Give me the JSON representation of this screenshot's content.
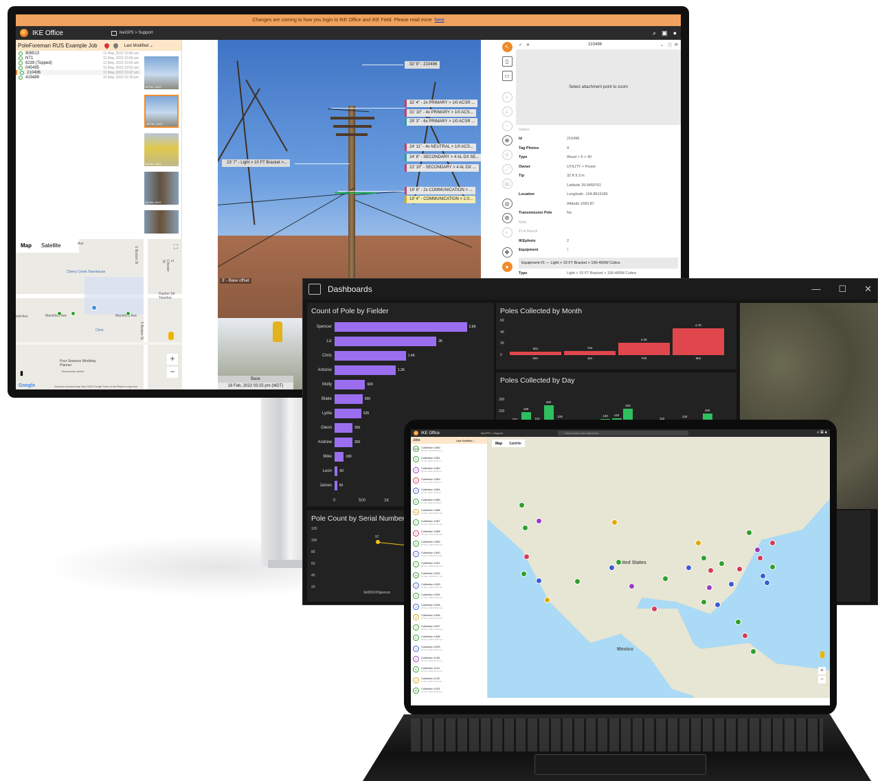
{
  "desktop": {
    "banner": {
      "text": "Changes are coming to how you login to IKE Office and IKE Field. Please read more",
      "link": "here"
    },
    "app_title": "IKE Office",
    "breadcrumb": "IkeGPS > Support",
    "job": {
      "name": "PoleForeman RUS Example Job",
      "sort_label": "Last Modified"
    },
    "poles": [
      {
        "id": "906513",
        "date": "11 May, 2022 10:55 am"
      },
      {
        "id": "NT1",
        "date": "11 May, 2022 10:55 am"
      },
      {
        "id": "6239 (Topped)",
        "date": "11 May, 2022 10:55 am"
      },
      {
        "id": "045495",
        "date": "11 May, 2022 10:52 am"
      },
      {
        "id": "210496",
        "date": "11 May, 2022 10:47 am"
      },
      {
        "id": "419489",
        "date": "10 May, 2022 02:30 pm"
      }
    ],
    "thumb_dates": [
      "18 Feb, 2022",
      "18 Feb, 2022",
      "18 Feb, 2022",
      "18 Feb, 2022"
    ],
    "map": {
      "tabs": [
        "Map",
        "Satellite"
      ],
      "labels": [
        "Cherry Creek Townhouse",
        "Dayton Str Townhor",
        "Mansfield Ave",
        "Mansfield Ave",
        "Four Seasons Wedding Planner",
        "Temporarily closed",
        "Chris",
        "S Boston St",
        "S Chester St",
        "Ave",
        "S Boston St",
        "ield Ave"
      ],
      "footer": "Keyboard shortcuts   Map data ©2022 Google   Terms of Use   Report a map error",
      "google": "Google"
    },
    "photo": {
      "callouts": [
        {
          "text": "32' 9\" - 210496",
          "style": "plain"
        },
        {
          "text": "32' 4\" - 2x PRIMARY > 1/0 ACSR ...",
          "style": "red"
        },
        {
          "text": "31' 10\" - 4x PRIMARY > 1/0 ACS...",
          "style": "red"
        },
        {
          "text": "29' 3\" - 6x PRIMARY > 1/0 ACSR ...",
          "style": "teal"
        },
        {
          "text": "24' 11\" - 4x NEUTRAL > 1/0 ACS...",
          "style": "red"
        },
        {
          "text": "24' 8\" - SECONDARY > 4 AL DX SE...",
          "style": "teal"
        },
        {
          "text": "22' 10\" - SECONDARY > 4 AL DX ...",
          "style": "red"
        },
        {
          "text": "19' 8\" - 2x COMMUNICATION > ...",
          "style": "red"
        },
        {
          "text": "19' 4\" - COMMUNICATION > 2.0...",
          "style": "yellow"
        },
        {
          "text": "23' 7\" - Light > 10 FT Bracket >...",
          "style": "plain"
        }
      ],
      "base_offset": "3' - Base offset",
      "footer_title": "Base",
      "footer_date": "18 Feb, 2022 03:25 pm (MDT)"
    },
    "attributes": {
      "pole_id": "210496",
      "zoom_hint": "Select attachment point to zoom",
      "rows": [
        {
          "k": "Status",
          "v": ""
        },
        {
          "k": "Id",
          "v": "210496"
        },
        {
          "k": "Tag Photos",
          "v": "4"
        },
        {
          "k": "Type",
          "v": "Wood > 6 > 40"
        },
        {
          "k": "Owner",
          "v": "UTILITY > Power"
        },
        {
          "k": "Tip",
          "v": "32         ft  9.3         in"
        },
        {
          "k": "",
          "v": "Latitude      39.6459761"
        },
        {
          "k": "Location",
          "v": "Longitude   -104.8819185"
        },
        {
          "k": "",
          "v": "Altitude       1683.87"
        },
        {
          "k": "Transmission Pole",
          "v": "No"
        },
        {
          "k": "Note",
          "v": ""
        },
        {
          "k": "PLA Result",
          "v": ""
        },
        {
          "k": "IKEphoto",
          "v": "2"
        },
        {
          "k": "Equipment",
          "v": "1"
        }
      ],
      "equipment_item": "Equipment #1 — Light > 10 FT Bracket > 150-400W Cobra",
      "type_row": {
        "k": "Type",
        "v": "Light > 10 FT Bracket > 150-400W Cobra"
      }
    }
  },
  "dashboard": {
    "title": "Dashboards",
    "cards": {
      "fielder_title": "Count of Pole by Fielder",
      "month_title": "Poles Collected by Month",
      "day_title": "Poles Collected by Day",
      "serial_title": "Pole Count by Serial Number"
    },
    "serial_axis": [
      "120",
      "100",
      "80",
      "60",
      "40",
      "20"
    ],
    "serial_point_label": "97",
    "serial_xlabel": "3e000XXSpencer"
  },
  "chart_data": [
    {
      "type": "bar",
      "orientation": "horizontal",
      "title": "Count of Pole by Fielder",
      "categories": [
        "Spencer",
        "Liz",
        "Chris",
        "Antonio",
        "Molly",
        "Blake",
        "Lydia",
        "Glenn",
        "Andrew",
        "Mike",
        "Leon",
        "James"
      ],
      "values": [
        2600,
        2000,
        1400,
        1200,
        600,
        550,
        525,
        350,
        350,
        180,
        60,
        50
      ],
      "value_labels": [
        "2.6K",
        "2K",
        "1.4K",
        "1.2K",
        "600",
        "550",
        "525",
        "350",
        "350",
        "180",
        "60",
        "50"
      ],
      "xticks": [
        "0",
        "500",
        "1K"
      ],
      "bar_color": "#9b6ef0"
    },
    {
      "type": "bar",
      "title": "Poles Collected by Month",
      "categories": [
        "Dec",
        "Jan",
        "Feb",
        "Mar"
      ],
      "values": [
        561,
        744,
        2200,
        4700
      ],
      "value_labels": [
        "561",
        "744",
        "2.2K",
        "4.7K"
      ],
      "yticks": [
        "6K",
        "4K",
        "2K",
        "0"
      ],
      "ylim": [
        0,
        6000
      ],
      "bar_color": "#e0474c"
    },
    {
      "type": "bar",
      "title": "Poles Collected by Day",
      "values": [
        100,
        190,
        110,
        250,
        125,
        25,
        35,
        85,
        130,
        140,
        225,
        62,
        90,
        110,
        40,
        125,
        38,
        180,
        40
      ],
      "yticks": [
        "300",
        "200",
        "100"
      ],
      "ylim": [
        0,
        300
      ],
      "bar_color": "#2fbf5f"
    }
  ],
  "tablet": {
    "app_title": "IKE Office",
    "breadcrumb": "IkeGPS > Support",
    "search_placeholder": "Search jobs and collections",
    "jobs_header": "Jobs",
    "sort_label": "Last Modified",
    "map_tabs": [
      "Map",
      "Satellite"
    ],
    "map_labels": {
      "us": "United States",
      "mexico": "Mexico"
    },
    "collections": [
      {
        "n": "348",
        "name": "Collection 1080",
        "date": "28 Jan, 2022 03:15 pm",
        "c": "#2e9f2e"
      },
      {
        "n": "5",
        "name": "Collection 1081",
        "date": "03 Jul, 2022 11:14 pm",
        "c": "#2e9f2e"
      },
      {
        "n": "2",
        "name": "Collection 1082",
        "date": "08 Jul, 2022 09:48 am",
        "c": "#9c3cc4"
      },
      {
        "n": "2",
        "name": "Collection 1083",
        "date": "13 Jul, 2022 04:56 pm",
        "c": "#d23c5c"
      },
      {
        "n": "2",
        "name": "Collection 1084",
        "date": "22 Jul, 2022 10:33 am",
        "c": "#3c5cd2"
      },
      {
        "n": "4",
        "name": "Collection 1085",
        "date": "21 Jul, 2022 02:18 pm",
        "c": "#2e9f2e"
      },
      {
        "n": "4",
        "name": "Collection 1086",
        "date": "15 Aug, 2022 08:40 am",
        "c": "#e0a800"
      },
      {
        "n": "1",
        "name": "Collection 1087",
        "date": "19 Aug, 2022 01:22 pm",
        "c": "#2e9f2e"
      },
      {
        "n": "2",
        "name": "Collection 1088",
        "date": "26 Aug, 2022 11:09 am",
        "c": "#d23c5c"
      },
      {
        "n": "5",
        "name": "Collection 1089",
        "date": "01 Sep, 2022 09:30 am",
        "c": "#2e9f2e"
      },
      {
        "n": "2",
        "name": "Collection 1090",
        "date": "05 Sep, 2022 04:11 pm",
        "c": "#3c5cd2"
      },
      {
        "n": "7",
        "name": "Collection 1091",
        "date": "08 Sep, 2022 10:02 am",
        "c": "#2e9f2e"
      },
      {
        "n": "12",
        "name": "Collection 1092",
        "date": "11 Sep, 2022 02:47 pm",
        "c": "#2e9f2e"
      },
      {
        "n": "2",
        "name": "Collection 1093",
        "date": "14 Sep, 2022 11:55 am",
        "c": "#3c5cd2"
      },
      {
        "n": "2",
        "name": "Collection 1094",
        "date": "17 Sep, 2022 03:20 pm",
        "c": "#2e9f2e"
      },
      {
        "n": "3",
        "name": "Collection 1095",
        "date": "20 Sep, 2022 09:14 am",
        "c": "#3c5cd2"
      },
      {
        "n": "2",
        "name": "Collection 1096",
        "date": "23 Sep, 2022 01:36 pm",
        "c": "#e0a800"
      },
      {
        "n": "1",
        "name": "Collection 1097",
        "date": "26 Sep, 2022 10:48 am",
        "c": "#2e9f2e"
      },
      {
        "n": "4",
        "name": "Collection 1098",
        "date": "29 Sep, 2022 04:05 pm",
        "c": "#2e9f2e"
      },
      {
        "n": "1",
        "name": "Collection 1099",
        "date": "02 Oct, 2022 08:57 am",
        "c": "#3c5cd2"
      },
      {
        "n": "4",
        "name": "Collection 1100",
        "date": "05 Oct, 2022 12:41 pm",
        "c": "#9c3cc4"
      },
      {
        "n": "8",
        "name": "Collection 1101",
        "date": "08 Oct, 2022 03:33 pm",
        "c": "#2e9f2e"
      },
      {
        "n": "1",
        "name": "Collection 1102",
        "date": "11 Oct, 2022 10:19 am",
        "c": "#e0a800"
      },
      {
        "n": "10",
        "name": "Collection 1103",
        "date": "14 Oct, 2022 02:08 pm",
        "c": "#2e9f2e"
      }
    ]
  }
}
